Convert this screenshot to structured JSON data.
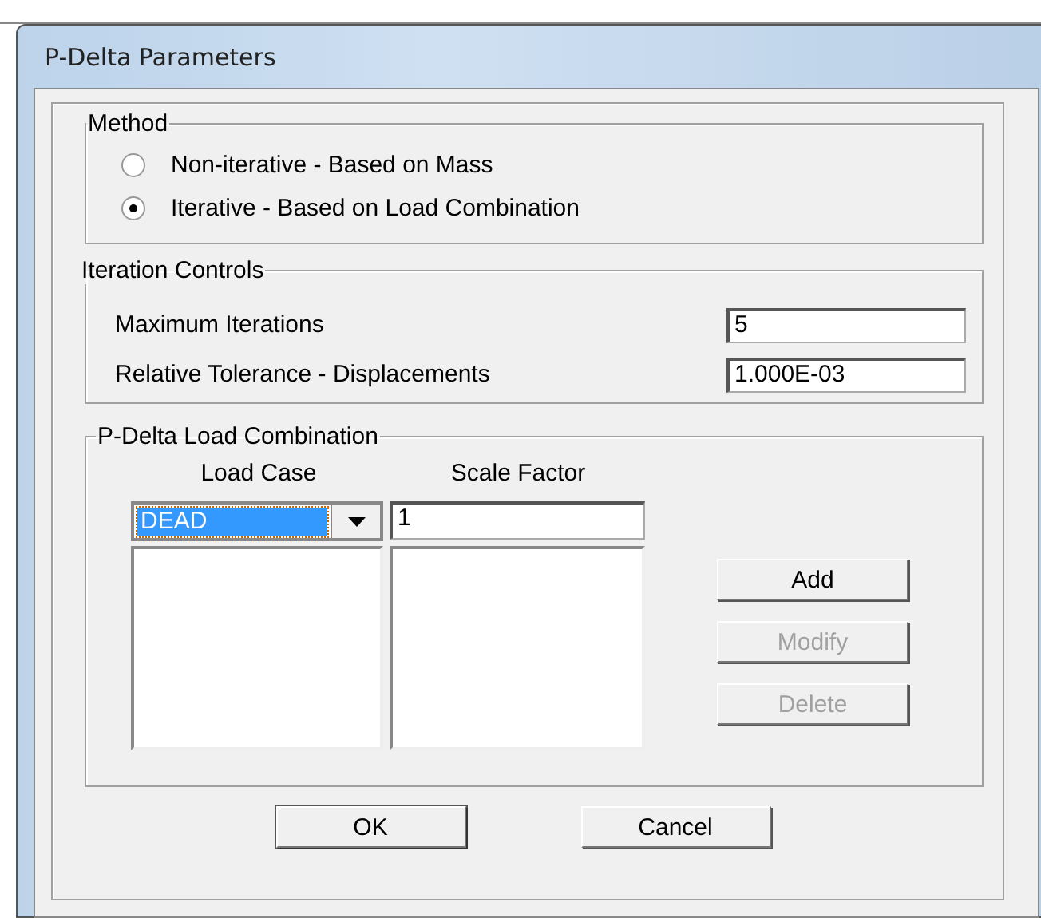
{
  "window": {
    "title": "P-Delta Parameters"
  },
  "method": {
    "title": "Method",
    "options": [
      {
        "label": "Non-iterative - Based on Mass",
        "selected": false
      },
      {
        "label": "Iterative - Based on Load Combination",
        "selected": true
      }
    ]
  },
  "iteration_controls": {
    "title": "Iteration Controls",
    "fields": [
      {
        "label": "Maximum Iterations",
        "value": "5"
      },
      {
        "label": "Relative Tolerance - Displacements",
        "value": "1.000E-03"
      }
    ]
  },
  "load_combination": {
    "title": "P-Delta Load Combination",
    "columns": [
      "Load Case",
      "Scale Factor"
    ],
    "load_case": "DEAD",
    "scale_factor": "1",
    "buttons": [
      {
        "label": "Add",
        "disabled": false
      },
      {
        "label": "Modify",
        "disabled": true
      },
      {
        "label": "Delete",
        "disabled": true
      }
    ]
  },
  "buttons": [
    "OK",
    "Cancel"
  ]
}
